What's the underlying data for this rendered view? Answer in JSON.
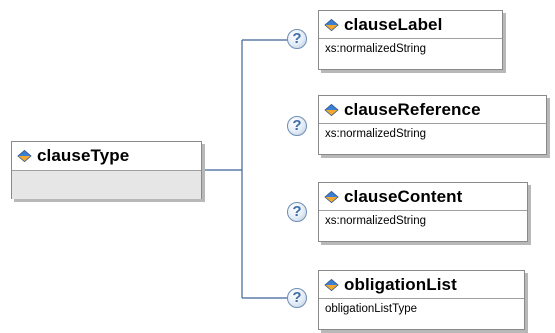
{
  "root": {
    "name": "clauseType"
  },
  "children": [
    {
      "name": "clauseLabel",
      "type": "xs:normalizedString"
    },
    {
      "name": "clauseReference",
      "type": "xs:normalizedString"
    },
    {
      "name": "clauseContent",
      "type": "xs:normalizedString"
    },
    {
      "name": "obligationList",
      "type": "obligationListType"
    }
  ],
  "help_glyph": "?",
  "colors": {
    "connector": "#3e6596",
    "diamond_top": "#3b7fd4",
    "diamond_bottom": "#f0a830",
    "help": "#3d6ea8"
  },
  "icons": {
    "element_marker": "diamond-icon",
    "annotation": "help-icon"
  }
}
